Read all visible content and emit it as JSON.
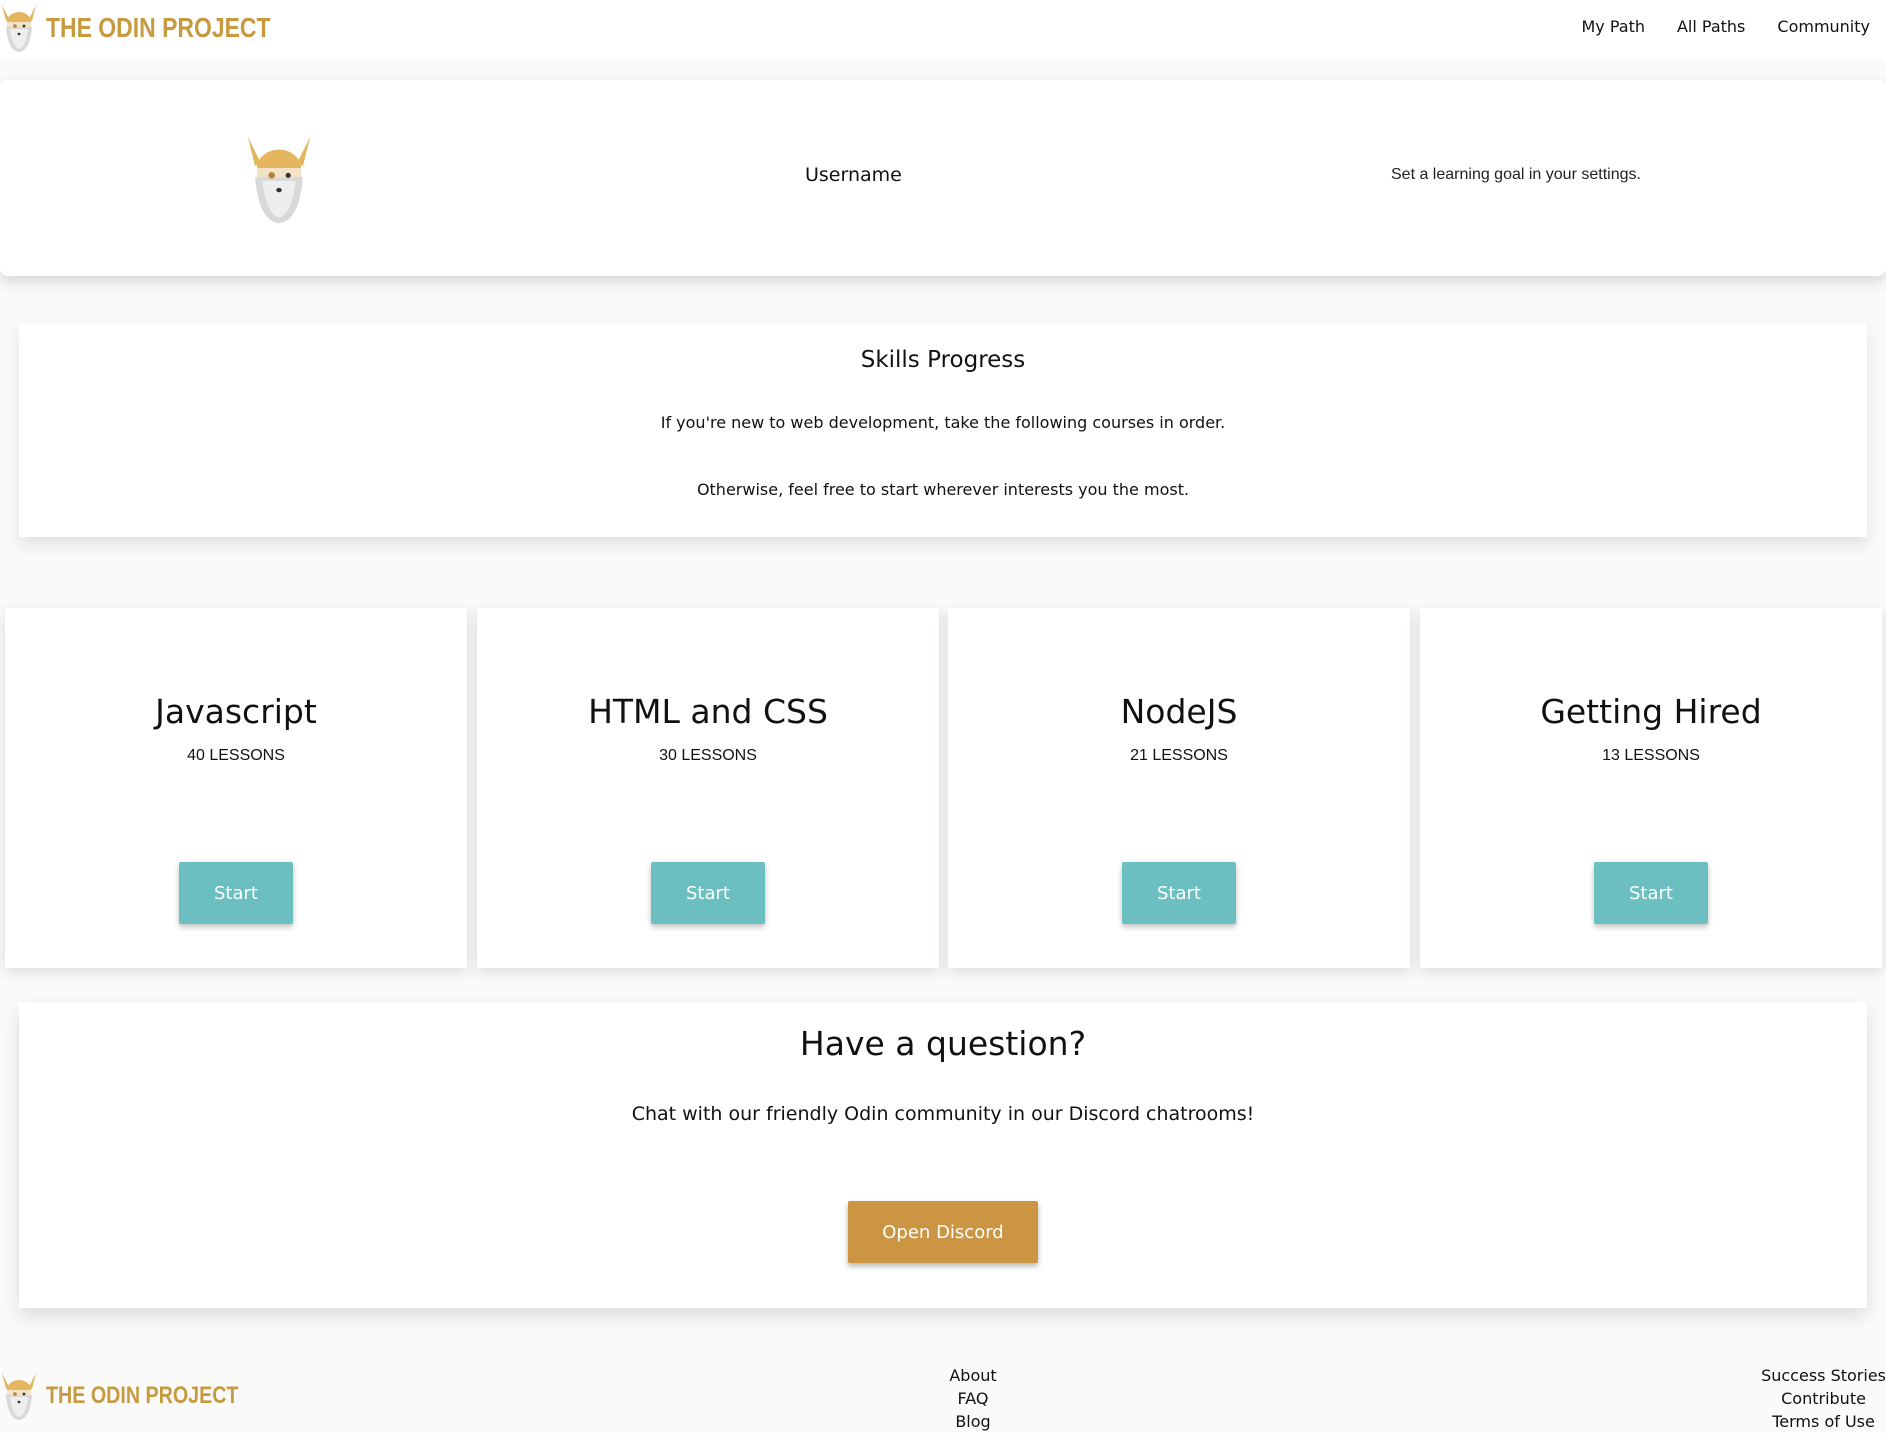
{
  "brand": {
    "name": "THE ODIN PROJECT",
    "color": "#c89a3f",
    "logo_icon": "odin-head-icon"
  },
  "nav": {
    "items": [
      "My Path",
      "All Paths",
      "Community"
    ]
  },
  "profile": {
    "username": "Username",
    "goal_text": "Set a learning goal in your settings.",
    "avatar_icon": "odin-head-icon"
  },
  "skills": {
    "title": "Skills Progress",
    "line1": "If you're new to web development, take the following courses in order.",
    "line2": "Otherwise, feel free to start wherever interests you the most."
  },
  "courses": [
    {
      "title": "Javascript",
      "lessons": "40 LESSONS",
      "button": "Start"
    },
    {
      "title": "HTML and CSS",
      "lessons": "30 LESSONS",
      "button": "Start"
    },
    {
      "title": "NodeJS",
      "lessons": "21 LESSONS",
      "button": "Start"
    },
    {
      "title": "Getting Hired",
      "lessons": "13 LESSONS",
      "button": "Start"
    }
  ],
  "question": {
    "title": "Have a question?",
    "text": "Chat with our friendly Odin community in our Discord chatrooms!",
    "button": "Open Discord"
  },
  "footer": {
    "brand": "THE ODIN PROJECT",
    "middle_links": [
      "About",
      "FAQ",
      "Blog"
    ],
    "right_links": [
      "Success Stories",
      "Contribute",
      "Terms of Use"
    ]
  },
  "colors": {
    "accent_teal": "#6cbfc1",
    "accent_gold": "#cc9543",
    "brand_gold": "#c89a3f"
  }
}
